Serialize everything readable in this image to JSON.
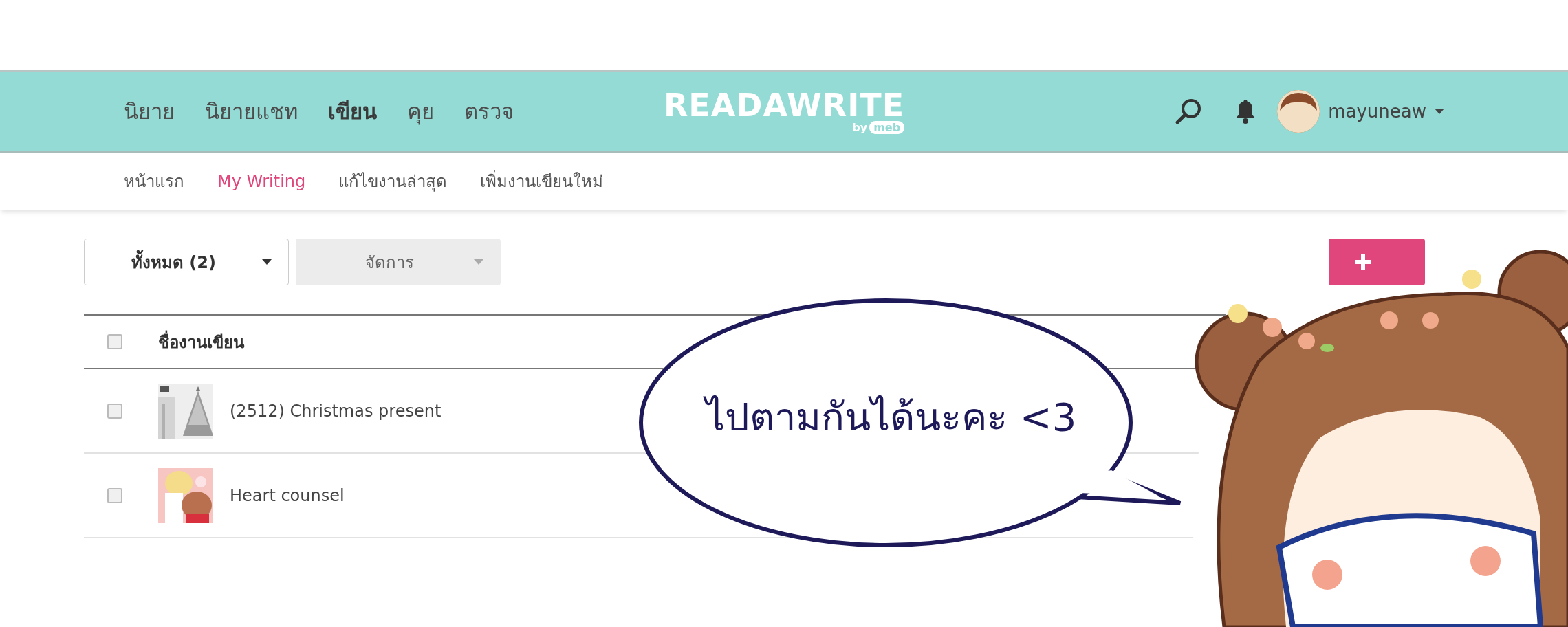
{
  "nav": {
    "items": [
      {
        "label": "นิยาย",
        "selected": false
      },
      {
        "label": "นิยายแชท",
        "selected": false
      },
      {
        "label": "เขียน",
        "selected": true
      },
      {
        "label": "คุย",
        "selected": false
      },
      {
        "label": "ตรวจ",
        "selected": false
      }
    ],
    "logo": {
      "text": "READAWRITE",
      "by": "by",
      "brand": "meb"
    },
    "username": "mayuneaw"
  },
  "subnav": {
    "items": [
      {
        "label": "หน้าแรก",
        "selected": false
      },
      {
        "label": "My Writing",
        "selected": true
      },
      {
        "label": "แก้ไขงานล่าสุด",
        "selected": false
      },
      {
        "label": "เพิ่มงานเขียนใหม่",
        "selected": false
      }
    ]
  },
  "toolbar": {
    "filter": "ทั้งหมด (2)",
    "manage": {
      "label": "จัดการ",
      "disabled": true
    }
  },
  "table": {
    "header": {
      "label": "ชื่องานเขียน",
      "checked": false
    },
    "rows": [
      {
        "title": "(2512) Christmas present",
        "checked": false,
        "kind": "picture"
      },
      {
        "title": "Heart counsel",
        "checked": false,
        "kind": "picture"
      }
    ]
  },
  "bubble": {
    "text": "ไปตามกันได้นะคะ <3"
  }
}
